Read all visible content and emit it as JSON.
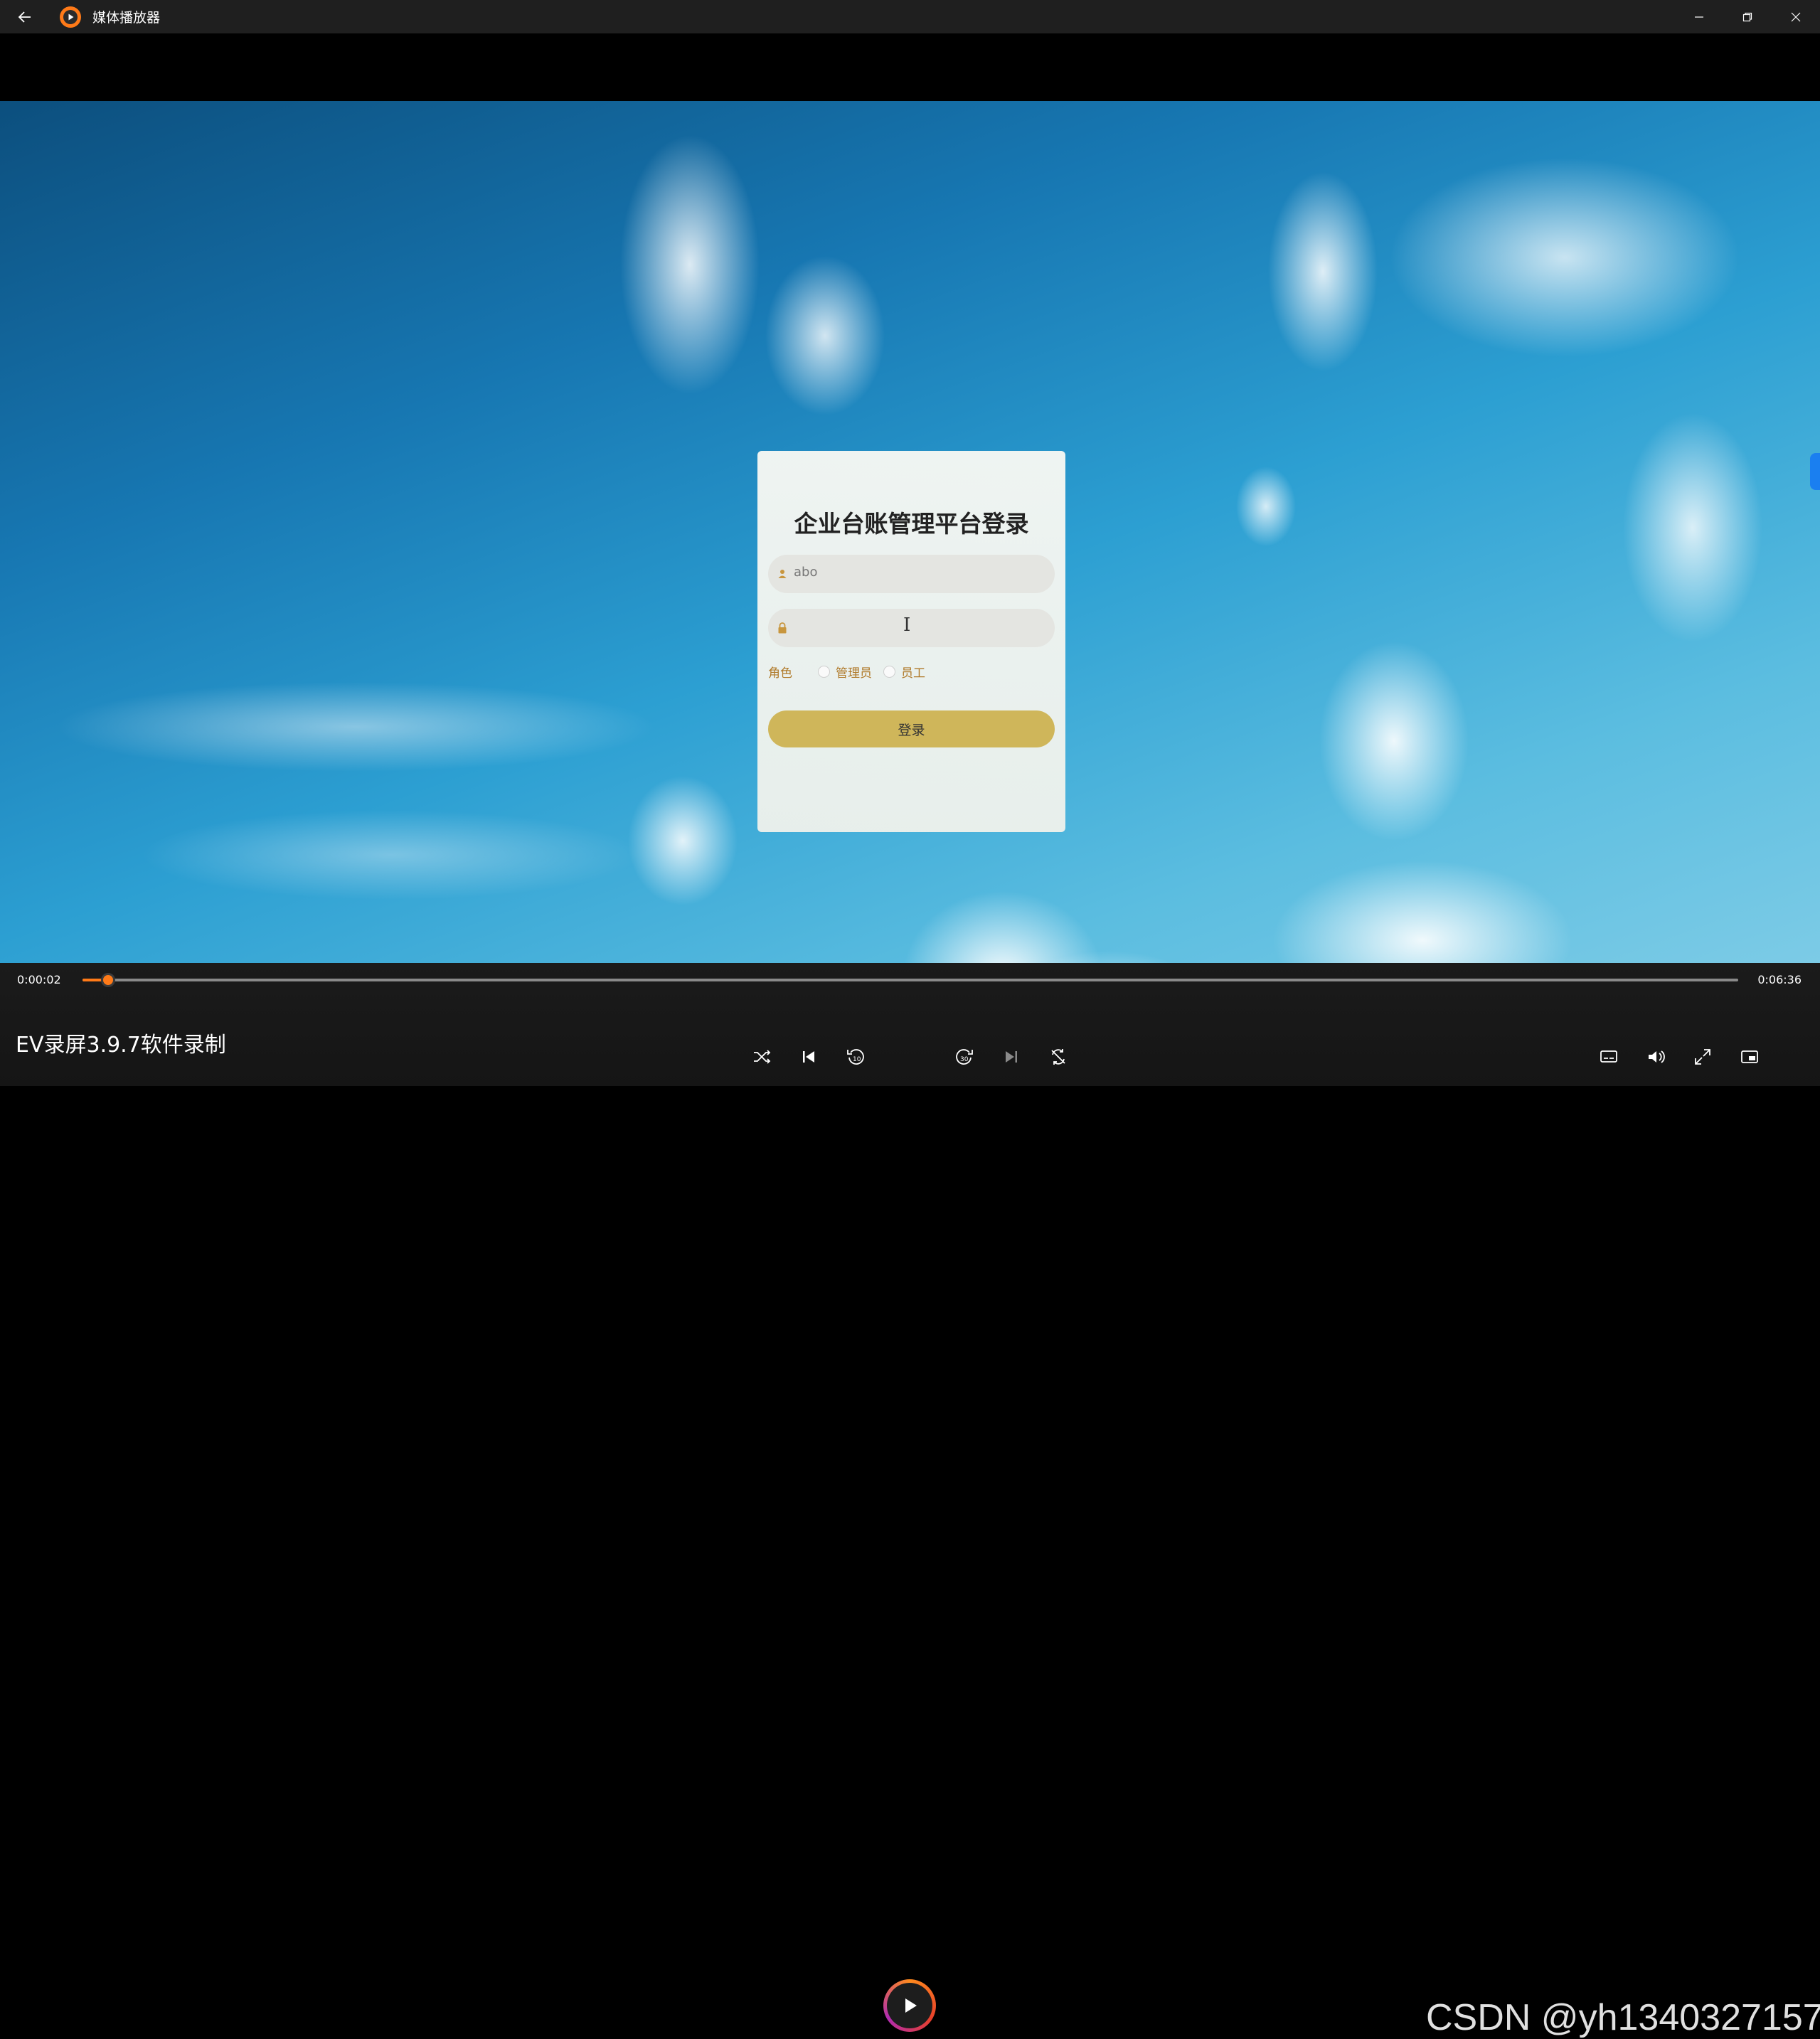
{
  "window": {
    "title": "媒体播放器",
    "back_icon": "arrow-left-icon",
    "app_icon": "media-player-logo-icon",
    "controls": [
      "minimize-icon",
      "restore-icon",
      "close-icon"
    ]
  },
  "login": {
    "title": "企业台账管理平台登录",
    "username_value": "abo",
    "password_value": "",
    "role_label": "角色",
    "roles": [
      "管理员",
      "员工"
    ],
    "submit_label": "登录",
    "accent_color": "#cfb65a"
  },
  "player": {
    "current_time": "0:00:02",
    "total_time": "0:06:36",
    "progress_fraction": 0.005,
    "media_title": "EV录屏3.9.7软件录制",
    "accent_color": "#ff7a18",
    "watermark": "CSDN @yh1340327157",
    "buttons": [
      "shuffle-icon",
      "previous-icon",
      "rewind-10-icon",
      "play-icon",
      "forward-30-icon",
      "next-icon",
      "repeat-icon",
      "subtitles-icon",
      "volume-icon",
      "fullscreen-icon",
      "mini-player-icon"
    ]
  }
}
